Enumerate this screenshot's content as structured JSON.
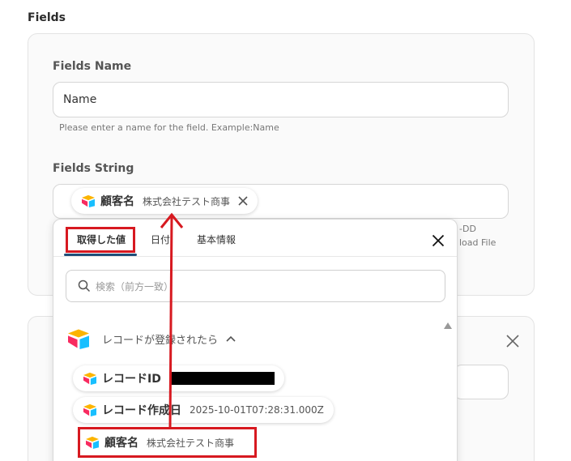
{
  "section_title": "Fields",
  "fields_name": {
    "label": "Fields Name",
    "value": "Name",
    "hint": "Please enter a name for the field. Example:Name"
  },
  "fields_string": {
    "label": "Fields String",
    "hint_fragment_1": "-DD",
    "hint_fragment_2": "load File",
    "chip": {
      "name": "顧客名",
      "value": "株式会社テスト商事"
    }
  },
  "popup": {
    "tabs": [
      {
        "label": "取得した値",
        "active": true
      },
      {
        "label": "日付",
        "active": false
      },
      {
        "label": "基本情報",
        "active": false
      }
    ],
    "search_placeholder": "検索（前方一致）",
    "group": {
      "label": "レコードが登録されたら"
    },
    "items": [
      {
        "name": "レコードID",
        "value": ""
      },
      {
        "name": "レコード作成日",
        "value": "2025-10-01T07:28:31.000Z"
      },
      {
        "name": "顧客名",
        "value": "株式会社テスト商事"
      }
    ]
  },
  "colors": {
    "accent_red": "#d71920",
    "tab_underline": "#1f4e79",
    "airtable_yellow": "#fcb400",
    "airtable_blue": "#18bfff",
    "airtable_red": "#f82b60"
  },
  "icons": [
    "airtable-icon",
    "search-icon",
    "close-icon",
    "chevron-up-icon",
    "scroll-up-icon"
  ]
}
